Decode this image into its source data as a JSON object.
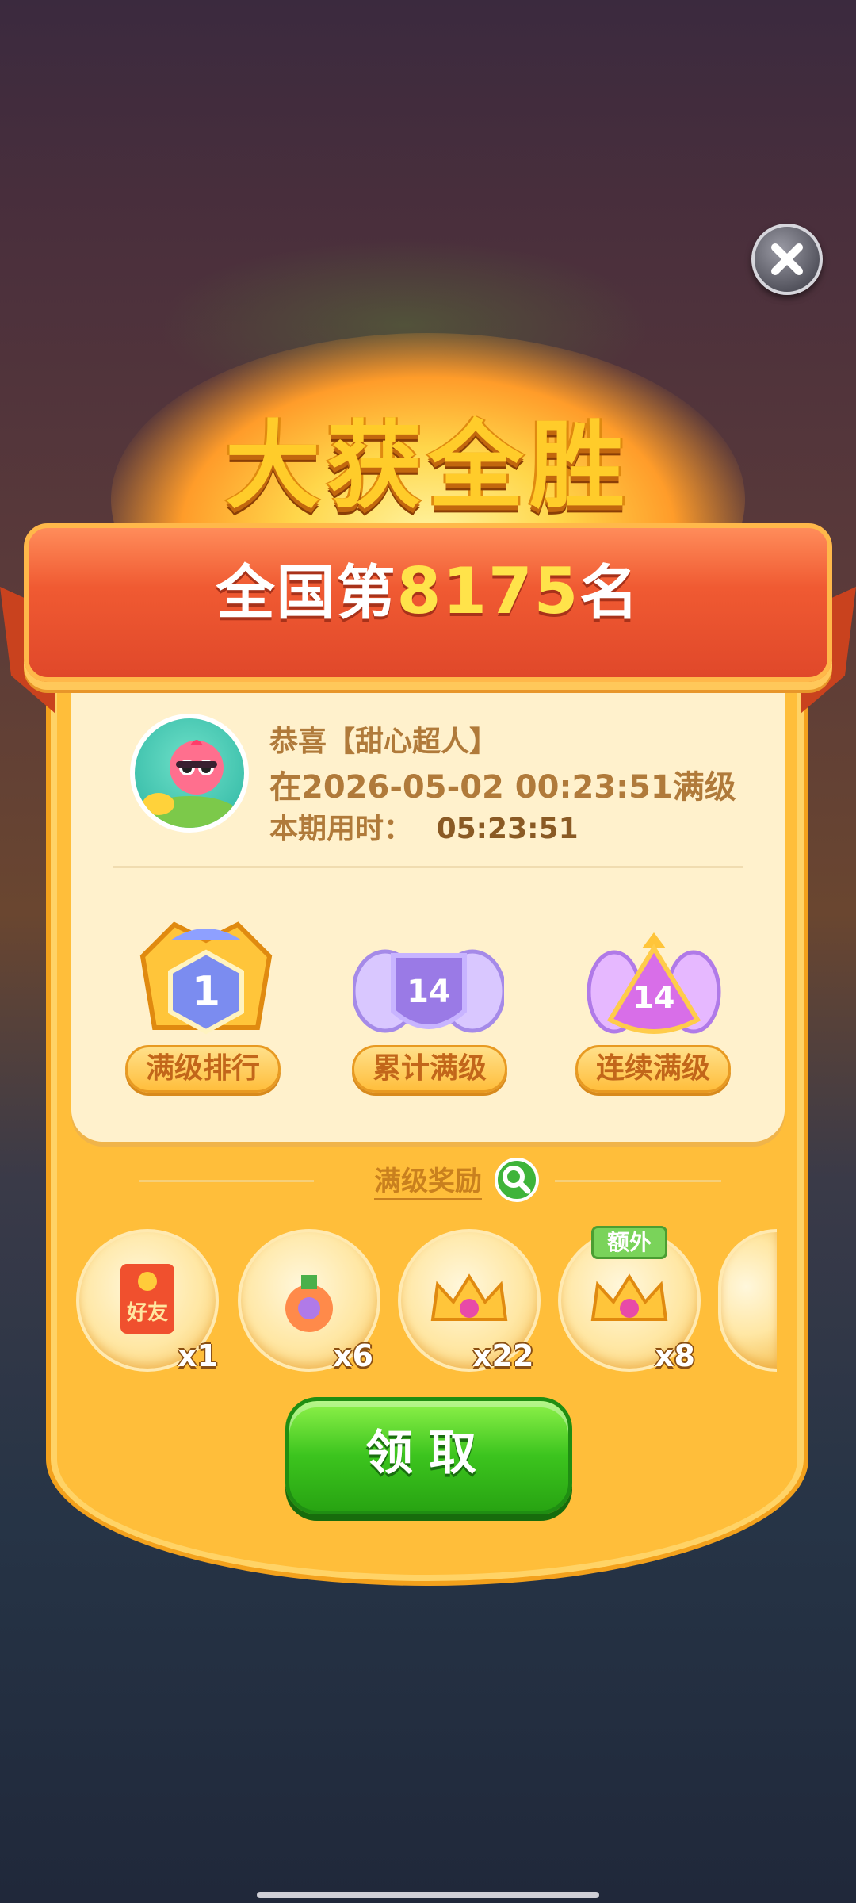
{
  "title": "大获全胜",
  "banner": {
    "prefix": "全国第",
    "rank": "8175",
    "suffix": "名"
  },
  "player": {
    "congrats": "恭喜【甜心超人】",
    "max_line": "在2026-05-02 00:23:51满级",
    "time_label": "本期用时：",
    "time_value": "05:23:51"
  },
  "badges": [
    {
      "label": "满级排行",
      "value": "1"
    },
    {
      "label": "累计满级",
      "value": "14"
    },
    {
      "label": "连续满级",
      "value": "14"
    }
  ],
  "rewards_title": "满级奖励",
  "rewards": [
    {
      "icon": "red-envelope-icon",
      "text": "好友",
      "count": "x1"
    },
    {
      "icon": "potion-icon",
      "count": "x6"
    },
    {
      "icon": "crown-icon",
      "count": "x22"
    },
    {
      "icon": "crown-icon",
      "count": "x8",
      "tag": "额外"
    }
  ],
  "claim_label": "领取",
  "colors": {
    "accent": "#ffcc2a",
    "ribbon": "#f05a32",
    "button": "#3cc41e"
  }
}
